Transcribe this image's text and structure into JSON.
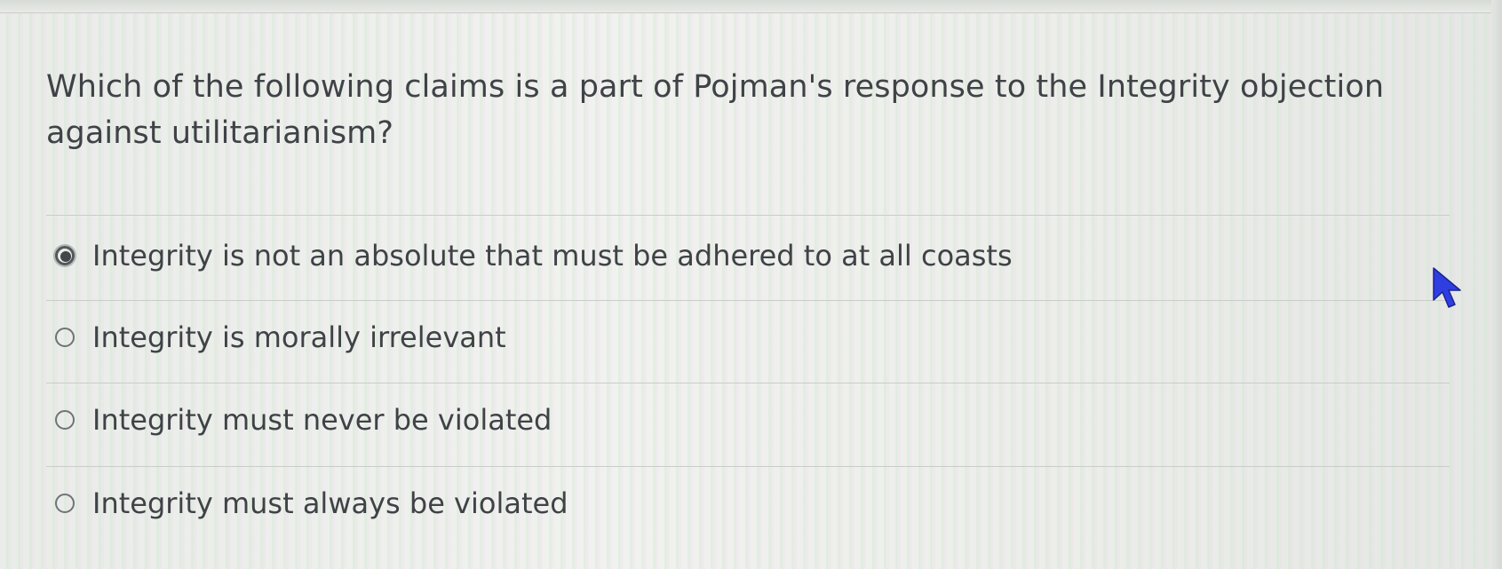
{
  "question": {
    "text": "Which of the following claims is a part of Pojman's response to the Integrity objection against utilitarianism?"
  },
  "options": [
    {
      "label": "Integrity is not an absolute that must be adhered to at all coasts",
      "selected": true
    },
    {
      "label": "Integrity is morally irrelevant",
      "selected": false
    },
    {
      "label": "Integrity must never be violated",
      "selected": false
    },
    {
      "label": "Integrity must always be violated",
      "selected": false
    }
  ],
  "colors": {
    "text": "#3f4246",
    "radio_border": "#6f7377",
    "cursor": "#2f3ee0"
  },
  "icons": {
    "cursor": "mouse-pointer-icon"
  }
}
